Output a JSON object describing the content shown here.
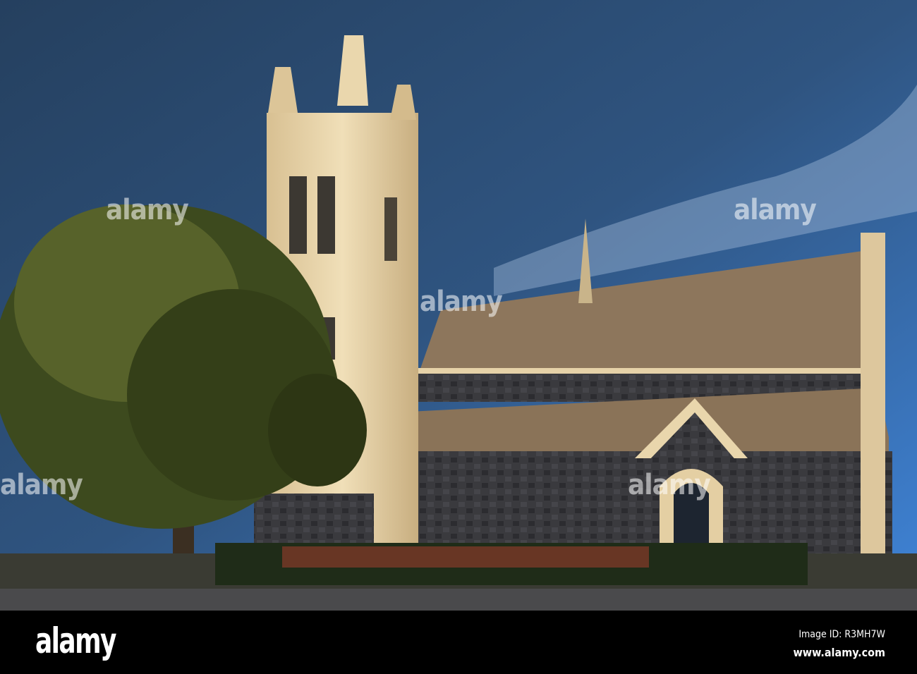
{
  "watermark": {
    "text": "alamy"
  },
  "footer": {
    "logo": "alamy",
    "image_id": "Image ID: R3MH7W",
    "website": "www.alamy.com"
  },
  "colors": {
    "sky_top": "#2c4566",
    "sky_right": "#3f7fd0",
    "stone": "#e8d4aa",
    "bluestone": "#3a3a3e",
    "roof": "#8a7258",
    "tree": "#3f4a1c"
  }
}
